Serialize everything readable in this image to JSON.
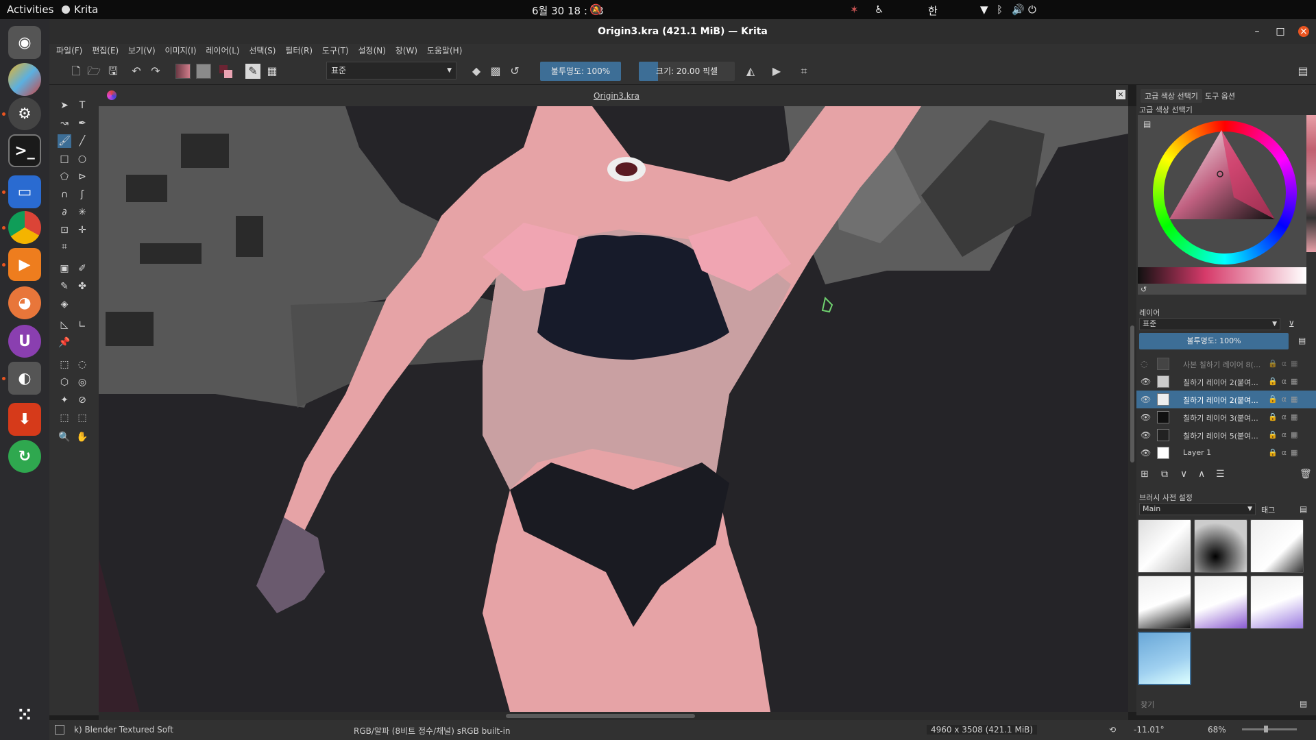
{
  "topbar": {
    "activities": "Activities",
    "app_name": "Krita",
    "datetime": "6월 30  18 : 03",
    "input_method": "한"
  },
  "window": {
    "title": "Origin3.kra (421.1 MiB) — Krita"
  },
  "menu": [
    "파일(F)",
    "편집(E)",
    "보기(V)",
    "이미지(I)",
    "레이어(L)",
    "선택(S)",
    "필터(R)",
    "도구(T)",
    "설정(N)",
    "창(W)",
    "도움말(H)"
  ],
  "toolbar": {
    "blend_mode": "표준",
    "opacity": "불투명도: 100%",
    "size": "크기: 20.00 픽셀"
  },
  "document": {
    "tab": "Origin3.kra"
  },
  "right_panel": {
    "tabs": [
      "고급 색상 선택기",
      "도구 옵션"
    ],
    "color_title": "고급 색상 선택기",
    "layers_title": "레이어",
    "layers_blend": "표준",
    "layers_opacity": "불투명도:  100%",
    "layers": [
      {
        "name": "사본 칠하기 레이어 8(..."
      },
      {
        "name": "칠하기 레이어 2(붙여..."
      },
      {
        "name": "칠하기 레이어 2(붙여..."
      },
      {
        "name": "칠하기 레이어 3(붙여..."
      },
      {
        "name": "칠하기 레이어 5(붙여..."
      },
      {
        "name": "Layer 1"
      }
    ],
    "brush_title": "브러시 사전 설정",
    "brush_tagset": "Main",
    "brush_tag": "태그",
    "search_placeholder": "찾기"
  },
  "status": {
    "brush": "k) Blender Textured Soft",
    "color": "RGB/알파 (8비트 정수/채널)  sRGB built-in",
    "size": "4960 x 3508 (421.1 MiB)",
    "rotation": "-11.01°",
    "zoom": "68%"
  },
  "colors": {
    "accent": "#3d6e96",
    "panel": "#313131"
  }
}
